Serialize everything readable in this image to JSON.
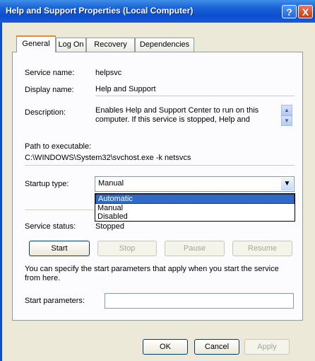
{
  "window": {
    "title": "Help and Support Properties (Local Computer)",
    "help_glyph": "?",
    "close_glyph": "X"
  },
  "tabs": [
    {
      "label": "General",
      "active": true
    },
    {
      "label": "Log On"
    },
    {
      "label": "Recovery"
    },
    {
      "label": "Dependencies"
    }
  ],
  "general": {
    "service_name_label": "Service name:",
    "service_name_value": "helpsvc",
    "display_name_label": "Display name:",
    "display_name_value": "Help and Support",
    "description_label": "Description:",
    "description_value": "Enables Help and Support Center to run on this computer. If this service is stopped, Help and",
    "path_label": "Path to executable:",
    "path_value": "C:\\WINDOWS\\System32\\svchost.exe -k netsvcs",
    "startup_type_label": "Startup type:",
    "startup_type_value": "Manual",
    "startup_options": [
      "Automatic",
      "Manual",
      "Disabled"
    ],
    "service_status_label": "Service status:",
    "service_status_value": "Stopped",
    "start_label": "Start",
    "stop_label": "Stop",
    "pause_label": "Pause",
    "resume_label": "Resume",
    "info_text": "You can specify the start parameters that apply when you start the service from here.",
    "start_params_label": "Start parameters:",
    "start_params_value": ""
  },
  "footer": {
    "ok_label": "OK",
    "cancel_label": "Cancel",
    "apply_label": "Apply"
  },
  "colors": {
    "titlebar": "#0a4fd0",
    "accent_tab": "#e68b2c",
    "selection": "#316ac5"
  },
  "icons": {
    "close": "close-icon",
    "help": "help-icon",
    "select": "chevron-down-icon",
    "scroll_up": "scroll-up-icon",
    "scroll_down": "scroll-down-icon"
  }
}
